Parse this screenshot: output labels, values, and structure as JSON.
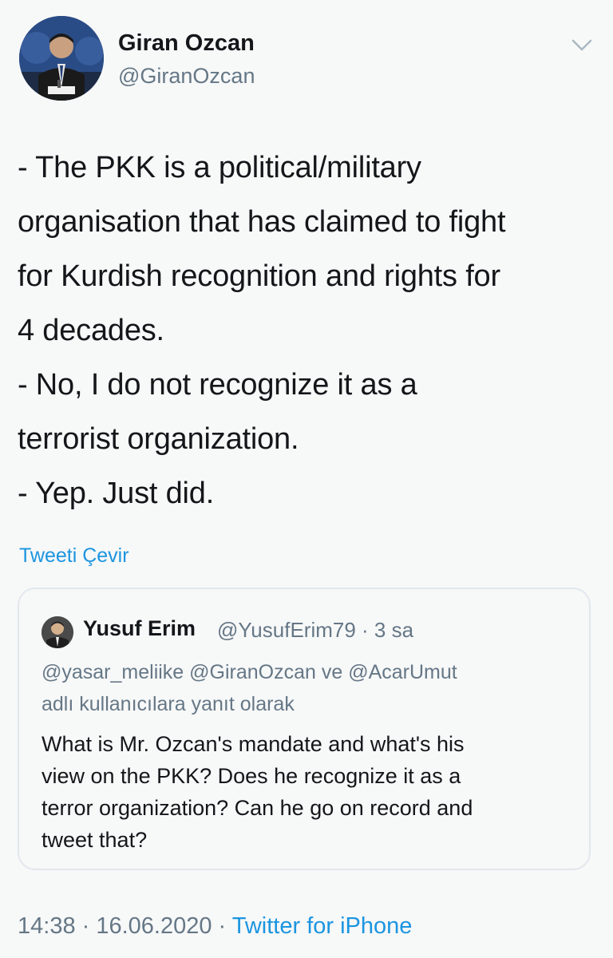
{
  "author": {
    "name": "Giran Ozcan",
    "handle": "@GiranOzcan"
  },
  "tweet": {
    "lines": [
      "- The PKK is a political/military",
      "organisation that has claimed to fight",
      "for Kurdish recognition and rights for",
      "4 decades.",
      "- No, I do not recognize it as a",
      "terrorist organization.",
      "- Yep. Just did."
    ]
  },
  "translate_label": "Tweeti Çevir",
  "quoted": {
    "name": "Yusuf Erim",
    "handle_time": "@YusufErim79 · 3 sa",
    "reply_lines": [
      "@yasar_meliike @GiranOzcan ve @AcarUmut",
      "adlı kullanıcılara yanıt olarak"
    ],
    "text_lines": [
      "What is Mr. Ozcan's mandate and what's his",
      "view on the PKK? Does he recognize it as a",
      "terror organization? Can he go on record and",
      "tweet that?"
    ]
  },
  "meta": {
    "time_date": "14:38 · 16.06.2020 · ",
    "source": "Twitter for iPhone"
  },
  "icons": {
    "caret": "chevron-down-icon"
  },
  "colors": {
    "link": "#1b95e0",
    "secondary": "#657786",
    "primary": "#14171a"
  }
}
